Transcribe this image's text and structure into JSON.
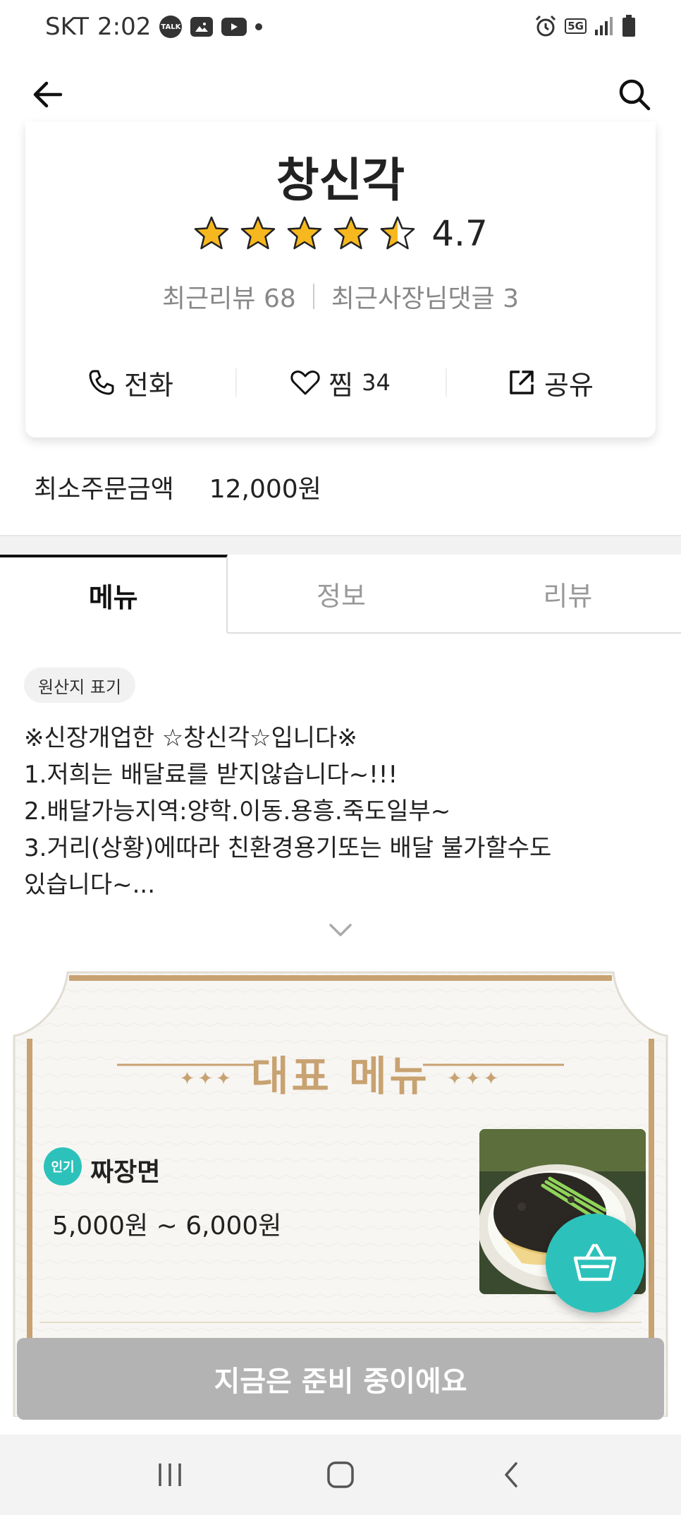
{
  "status_bar": {
    "carrier": "SKT",
    "time": "2:02",
    "icons_left": [
      "talk-icon",
      "gallery-icon",
      "youtube-icon",
      "dot-icon"
    ],
    "icons_right": [
      "alarm-icon",
      "5g-icon",
      "signal-icon",
      "battery-icon"
    ],
    "talk_label": "TALK",
    "network_label": "5G"
  },
  "app_bar": {
    "icons": [
      "back-arrow-icon",
      "search-icon"
    ]
  },
  "store": {
    "name": "창신각",
    "rating": "4.7",
    "rating_value": 4.7,
    "stars_filled": 4.5,
    "recent_reviews_label": "최근리뷰",
    "recent_reviews_count": "68",
    "owner_replies_label": "최근사장님댓글",
    "owner_replies_count": "3",
    "actions": {
      "call_label": "전화",
      "like_label": "찜",
      "like_count": "34",
      "share_label": "공유"
    }
  },
  "min_order": {
    "label": "최소주문금액",
    "value": "12,000원"
  },
  "tabs": [
    {
      "label": "메뉴",
      "active": true
    },
    {
      "label": "정보",
      "active": false
    },
    {
      "label": "리뷰",
      "active": false
    }
  ],
  "origin_chip": "원산지 표기",
  "notice_lines": [
    "※신장개업한 ☆창신각☆입니다※",
    "1.저희는 배달료를 받지않습니다~!!!",
    "2.배달가능지역:양학.이동.용흥.죽도일부~",
    "3.거리(상황)에따라 친환경용기또는 배달 불가할수도",
    "있습니다~..."
  ],
  "signature": {
    "title": "대표 메뉴",
    "item": {
      "badge": "인기",
      "name": "짜장면",
      "price": "5,000원 ~ 6,000원"
    }
  },
  "prep_button": "지금은 준비 중이에요",
  "colors": {
    "accent": "#2cc2bb",
    "gold": "#c8a271",
    "disabled": "#b3b3b3"
  }
}
